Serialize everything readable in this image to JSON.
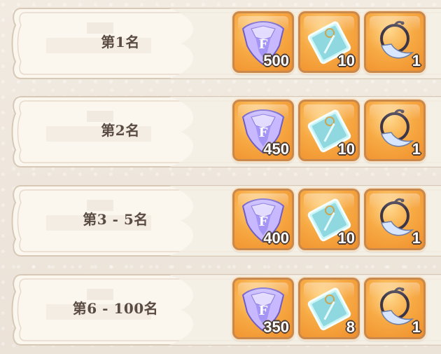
{
  "colors": {
    "background": "#efe7dd",
    "panel": "#fbf7ef",
    "panel_border": "#d8c8b6",
    "rank_text": "#5b4c43",
    "item_orange": "#f7aa44",
    "item_border": "#c9894d"
  },
  "rewards": [
    {
      "rank": "第1名",
      "items": [
        {
          "icon": "crystal-icon",
          "count": "500"
        },
        {
          "icon": "ticket-icon",
          "count": "10"
        },
        {
          "icon": "moon-pendant-icon",
          "count": "1"
        }
      ]
    },
    {
      "rank": "第2名",
      "items": [
        {
          "icon": "crystal-icon",
          "count": "450"
        },
        {
          "icon": "ticket-icon",
          "count": "10"
        },
        {
          "icon": "moon-pendant-icon",
          "count": "1"
        }
      ]
    },
    {
      "rank": "第3 - 5名",
      "items": [
        {
          "icon": "crystal-icon",
          "count": "400"
        },
        {
          "icon": "ticket-icon",
          "count": "10"
        },
        {
          "icon": "moon-pendant-icon",
          "count": "1"
        }
      ]
    },
    {
      "rank": "第6 - 100名",
      "items": [
        {
          "icon": "crystal-icon",
          "count": "350"
        },
        {
          "icon": "ticket-icon",
          "count": "8"
        },
        {
          "icon": "moon-pendant-icon",
          "count": "1"
        }
      ]
    }
  ]
}
